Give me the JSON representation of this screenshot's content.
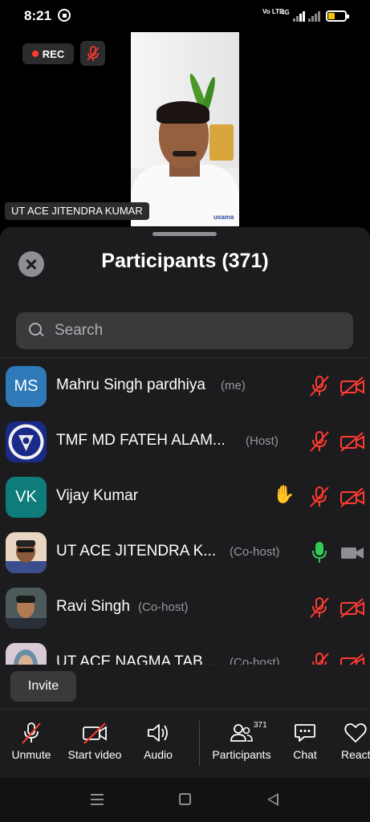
{
  "status": {
    "time": "8:21",
    "volte": "Vo LTE",
    "network": "4G"
  },
  "video": {
    "rec_label": "REC",
    "speaker_name": "UT ACE JITENDRA KUMAR",
    "watermark": "usama"
  },
  "panel": {
    "title": "Participants (371)",
    "search_placeholder": "Search"
  },
  "participants": [
    {
      "initials": "MS",
      "avatar_color": "#2f79b8",
      "name": "Mahru Singh pardhiya",
      "role": "(me)",
      "mic": "muted",
      "video": "off",
      "hand": false
    },
    {
      "initials": "",
      "avatar_color": "#1a2a88",
      "name": "TMF MD FATEH ALAM...",
      "role": "(Host)",
      "mic": "muted",
      "video": "off",
      "hand": false
    },
    {
      "initials": "VK",
      "avatar_color": "#0e7c7b",
      "name": "Vijay Kumar",
      "role": "",
      "mic": "muted",
      "video": "off",
      "hand": true,
      "hand_icon": "✋"
    },
    {
      "initials": "",
      "avatar_color": "#d7b08a",
      "name": "UT ACE JITENDRA K...",
      "role": "(Co-host)",
      "mic": "on",
      "video": "on",
      "hand": false
    },
    {
      "initials": "",
      "avatar_color": "#3b3b45",
      "name": "Ravi Singh",
      "role": "(Co-host)",
      "mic": "muted",
      "video": "off",
      "hand": false
    },
    {
      "initials": "",
      "avatar_color": "#c9b8c8",
      "name": "UT ACE NAGMA TAB...",
      "role": "(Co-host)",
      "mic": "muted",
      "video": "off",
      "hand": false
    }
  ],
  "invite_label": "Invite",
  "toolbar": {
    "unmute": "Unmute",
    "start_video": "Start video",
    "audio": "Audio",
    "participants": "Participants",
    "participants_count": "371",
    "chat": "Chat",
    "react": "React"
  },
  "colors": {
    "muted_red": "#ff3b30",
    "active_green": "#34c759",
    "panel_bg": "#1c1c1e"
  }
}
